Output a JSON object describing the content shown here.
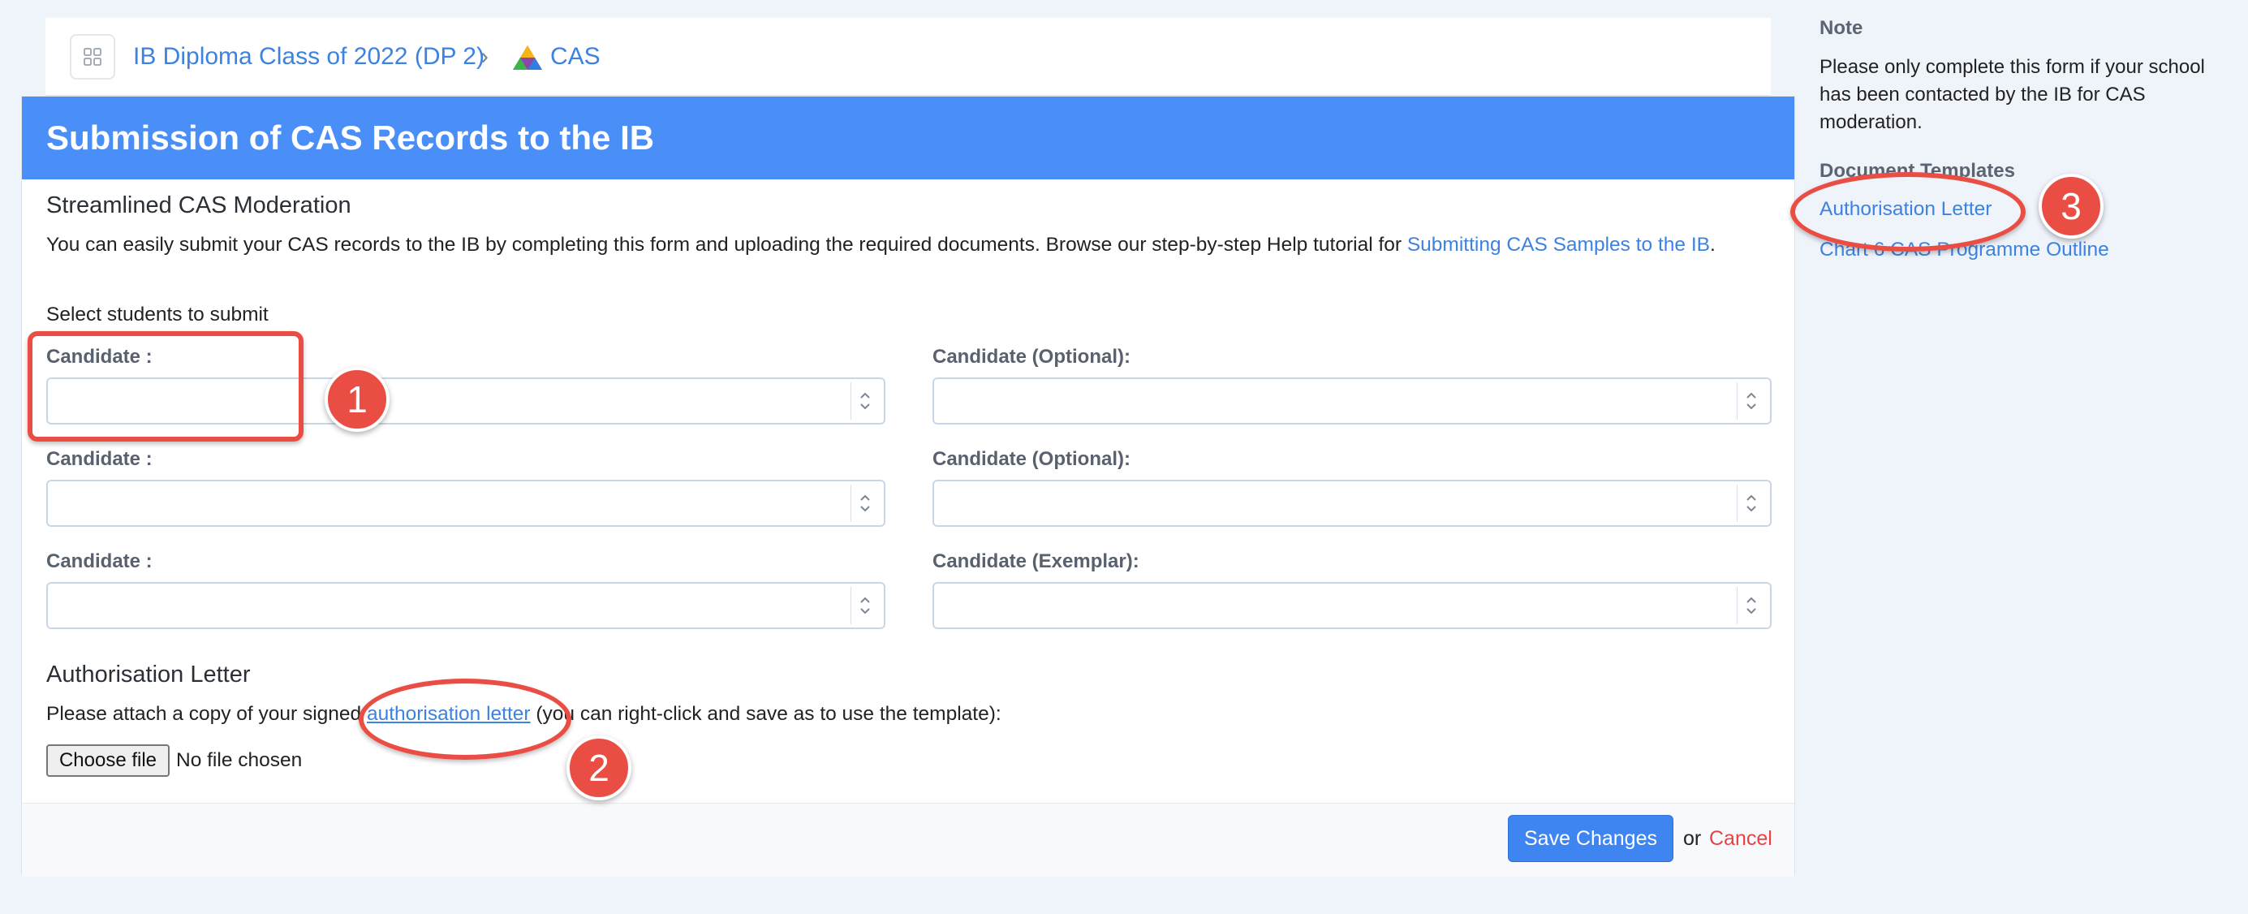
{
  "breadcrumb": {
    "parent": "IB Diploma Class of 2022 (DP 2)",
    "separator": "›",
    "current": "CAS"
  },
  "form": {
    "title": "Submission of CAS Records to the IB",
    "section_title": "Streamlined CAS Moderation",
    "intro_text": "You can easily submit your CAS records to the IB by completing this form and uploading the required documents. Browse our step-by-step Help tutorial for ",
    "intro_link": "Submitting CAS Samples to the IB",
    "intro_end": ".",
    "select_label": "Select students to submit",
    "fields": [
      {
        "label": "Candidate :",
        "value": ""
      },
      {
        "label": "Candidate (Optional):",
        "value": ""
      },
      {
        "label": "Candidate :",
        "value": ""
      },
      {
        "label": "Candidate (Optional):",
        "value": ""
      },
      {
        "label": "Candidate :",
        "value": ""
      },
      {
        "label": "Candidate (Exemplar):",
        "value": ""
      }
    ],
    "auth_title": "Authorisation Letter",
    "auth_text_before": "Please attach a copy of your signed ",
    "auth_link": "authorisation letter",
    "auth_text_after": " (you can right-click and save as to use the template):",
    "file_button": "Choose file",
    "file_status": "No file chosen",
    "save_label": "Save Changes",
    "or_text": "or",
    "cancel_label": "Cancel"
  },
  "sidebar": {
    "note_title": "Note",
    "note_text": "Please only complete this form if your school has been contacted by the IB for CAS moderation.",
    "templates_title": "Document Templates",
    "templates": [
      "Authorisation Letter",
      "Chart 6 CAS Programme Outline"
    ]
  },
  "annotations": {
    "badges": [
      "1",
      "2",
      "3"
    ],
    "color": "#ea4d43"
  },
  "colors": {
    "header_blue": "#4a8ff7",
    "link_blue": "#3d82e0",
    "cancel_red": "#e84242",
    "page_bg": "#eff3fa"
  }
}
